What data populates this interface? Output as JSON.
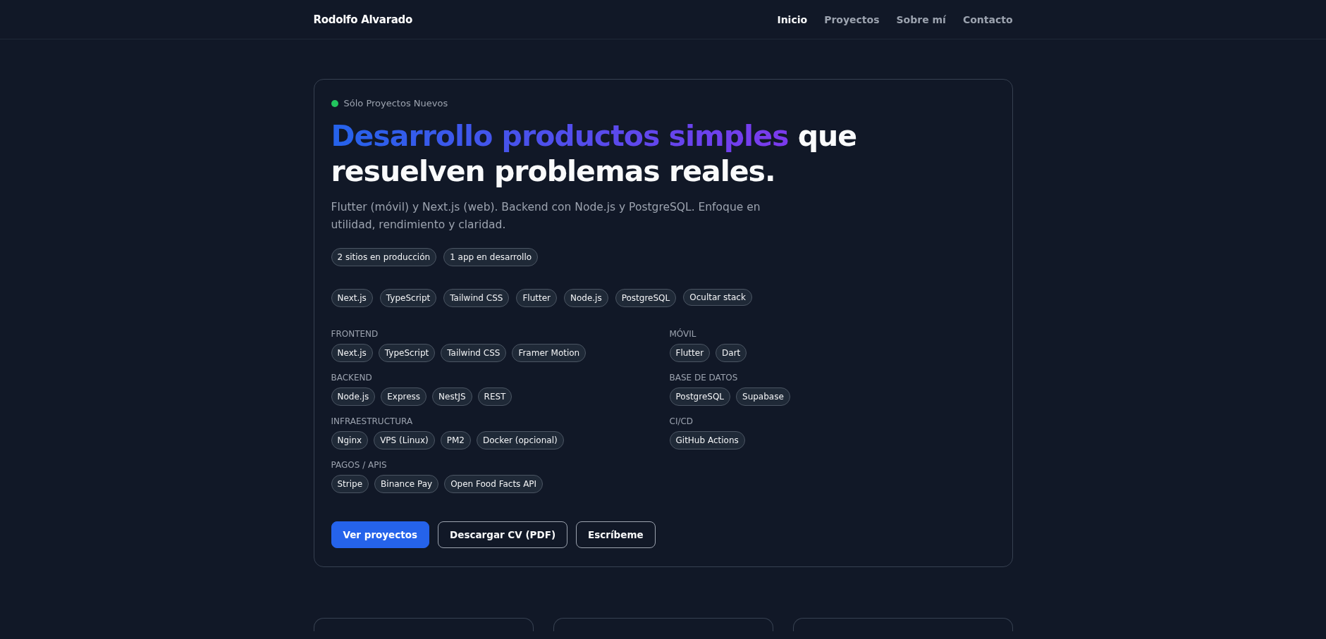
{
  "nav": {
    "brand": "Rodolfo Alvarado",
    "links": [
      {
        "label": "Inicio",
        "selected": true
      },
      {
        "label": "Proyectos",
        "selected": false
      },
      {
        "label": "Sobre mí",
        "selected": false
      },
      {
        "label": "Contacto",
        "selected": false
      }
    ]
  },
  "hero": {
    "status": {
      "label": "Sólo Proyectos Nuevos",
      "color": "#22c55e"
    },
    "headline": {
      "highlight": "Desarrollo productos simples",
      "rest": "que resuelven problemas reales."
    },
    "description": "Flutter (móvil) y Next.js (web). Backend con Node.js y PostgreSQL. Enfoque en utilidad, rendimiento y claridad.",
    "stats": [
      "2 sitios en producción",
      "1 app en desarrollo"
    ],
    "stack": [
      {
        "label": "Next.js",
        "kind": "tag"
      },
      {
        "label": "TypeScript",
        "kind": "tag"
      },
      {
        "label": "Tailwind CSS",
        "kind": "tag"
      },
      {
        "label": "Flutter",
        "kind": "tag"
      },
      {
        "label": "Node.js",
        "kind": "tag"
      },
      {
        "label": "PostgreSQL",
        "kind": "tag"
      },
      {
        "label": "Ocultar stack",
        "kind": "toggle"
      }
    ],
    "categories": [
      {
        "title": "FRONTEND",
        "items": [
          "Next.js",
          "TypeScript",
          "Tailwind CSS",
          "Framer Motion"
        ]
      },
      {
        "title": "MÓVIL",
        "items": [
          "Flutter",
          "Dart"
        ]
      },
      {
        "title": "BACKEND",
        "items": [
          "Node.js",
          "Express",
          "NestJS",
          "REST"
        ]
      },
      {
        "title": "BASE DE DATOS",
        "items": [
          "PostgreSQL",
          "Supabase"
        ]
      },
      {
        "title": "INFRAESTRUCTURA",
        "items": [
          "Nginx",
          "VPS (Linux)",
          "PM2",
          "Docker (opcional)"
        ]
      },
      {
        "title": "CI/CD",
        "items": [
          "GitHub Actions"
        ]
      },
      {
        "title": "PAGOS / APIS",
        "items": [
          "Stripe",
          "Binance Pay",
          "Open Food Facts API"
        ]
      }
    ],
    "buttons": [
      {
        "label": "Ver proyectos",
        "kind": "primary"
      },
      {
        "label": "Descargar CV (PDF)",
        "kind": "outline"
      },
      {
        "label": "Escríbeme",
        "kind": "outline"
      }
    ]
  },
  "cards": [
    {
      "kind": "card"
    },
    {
      "kind": "card"
    },
    {
      "kind": "card"
    }
  ]
}
